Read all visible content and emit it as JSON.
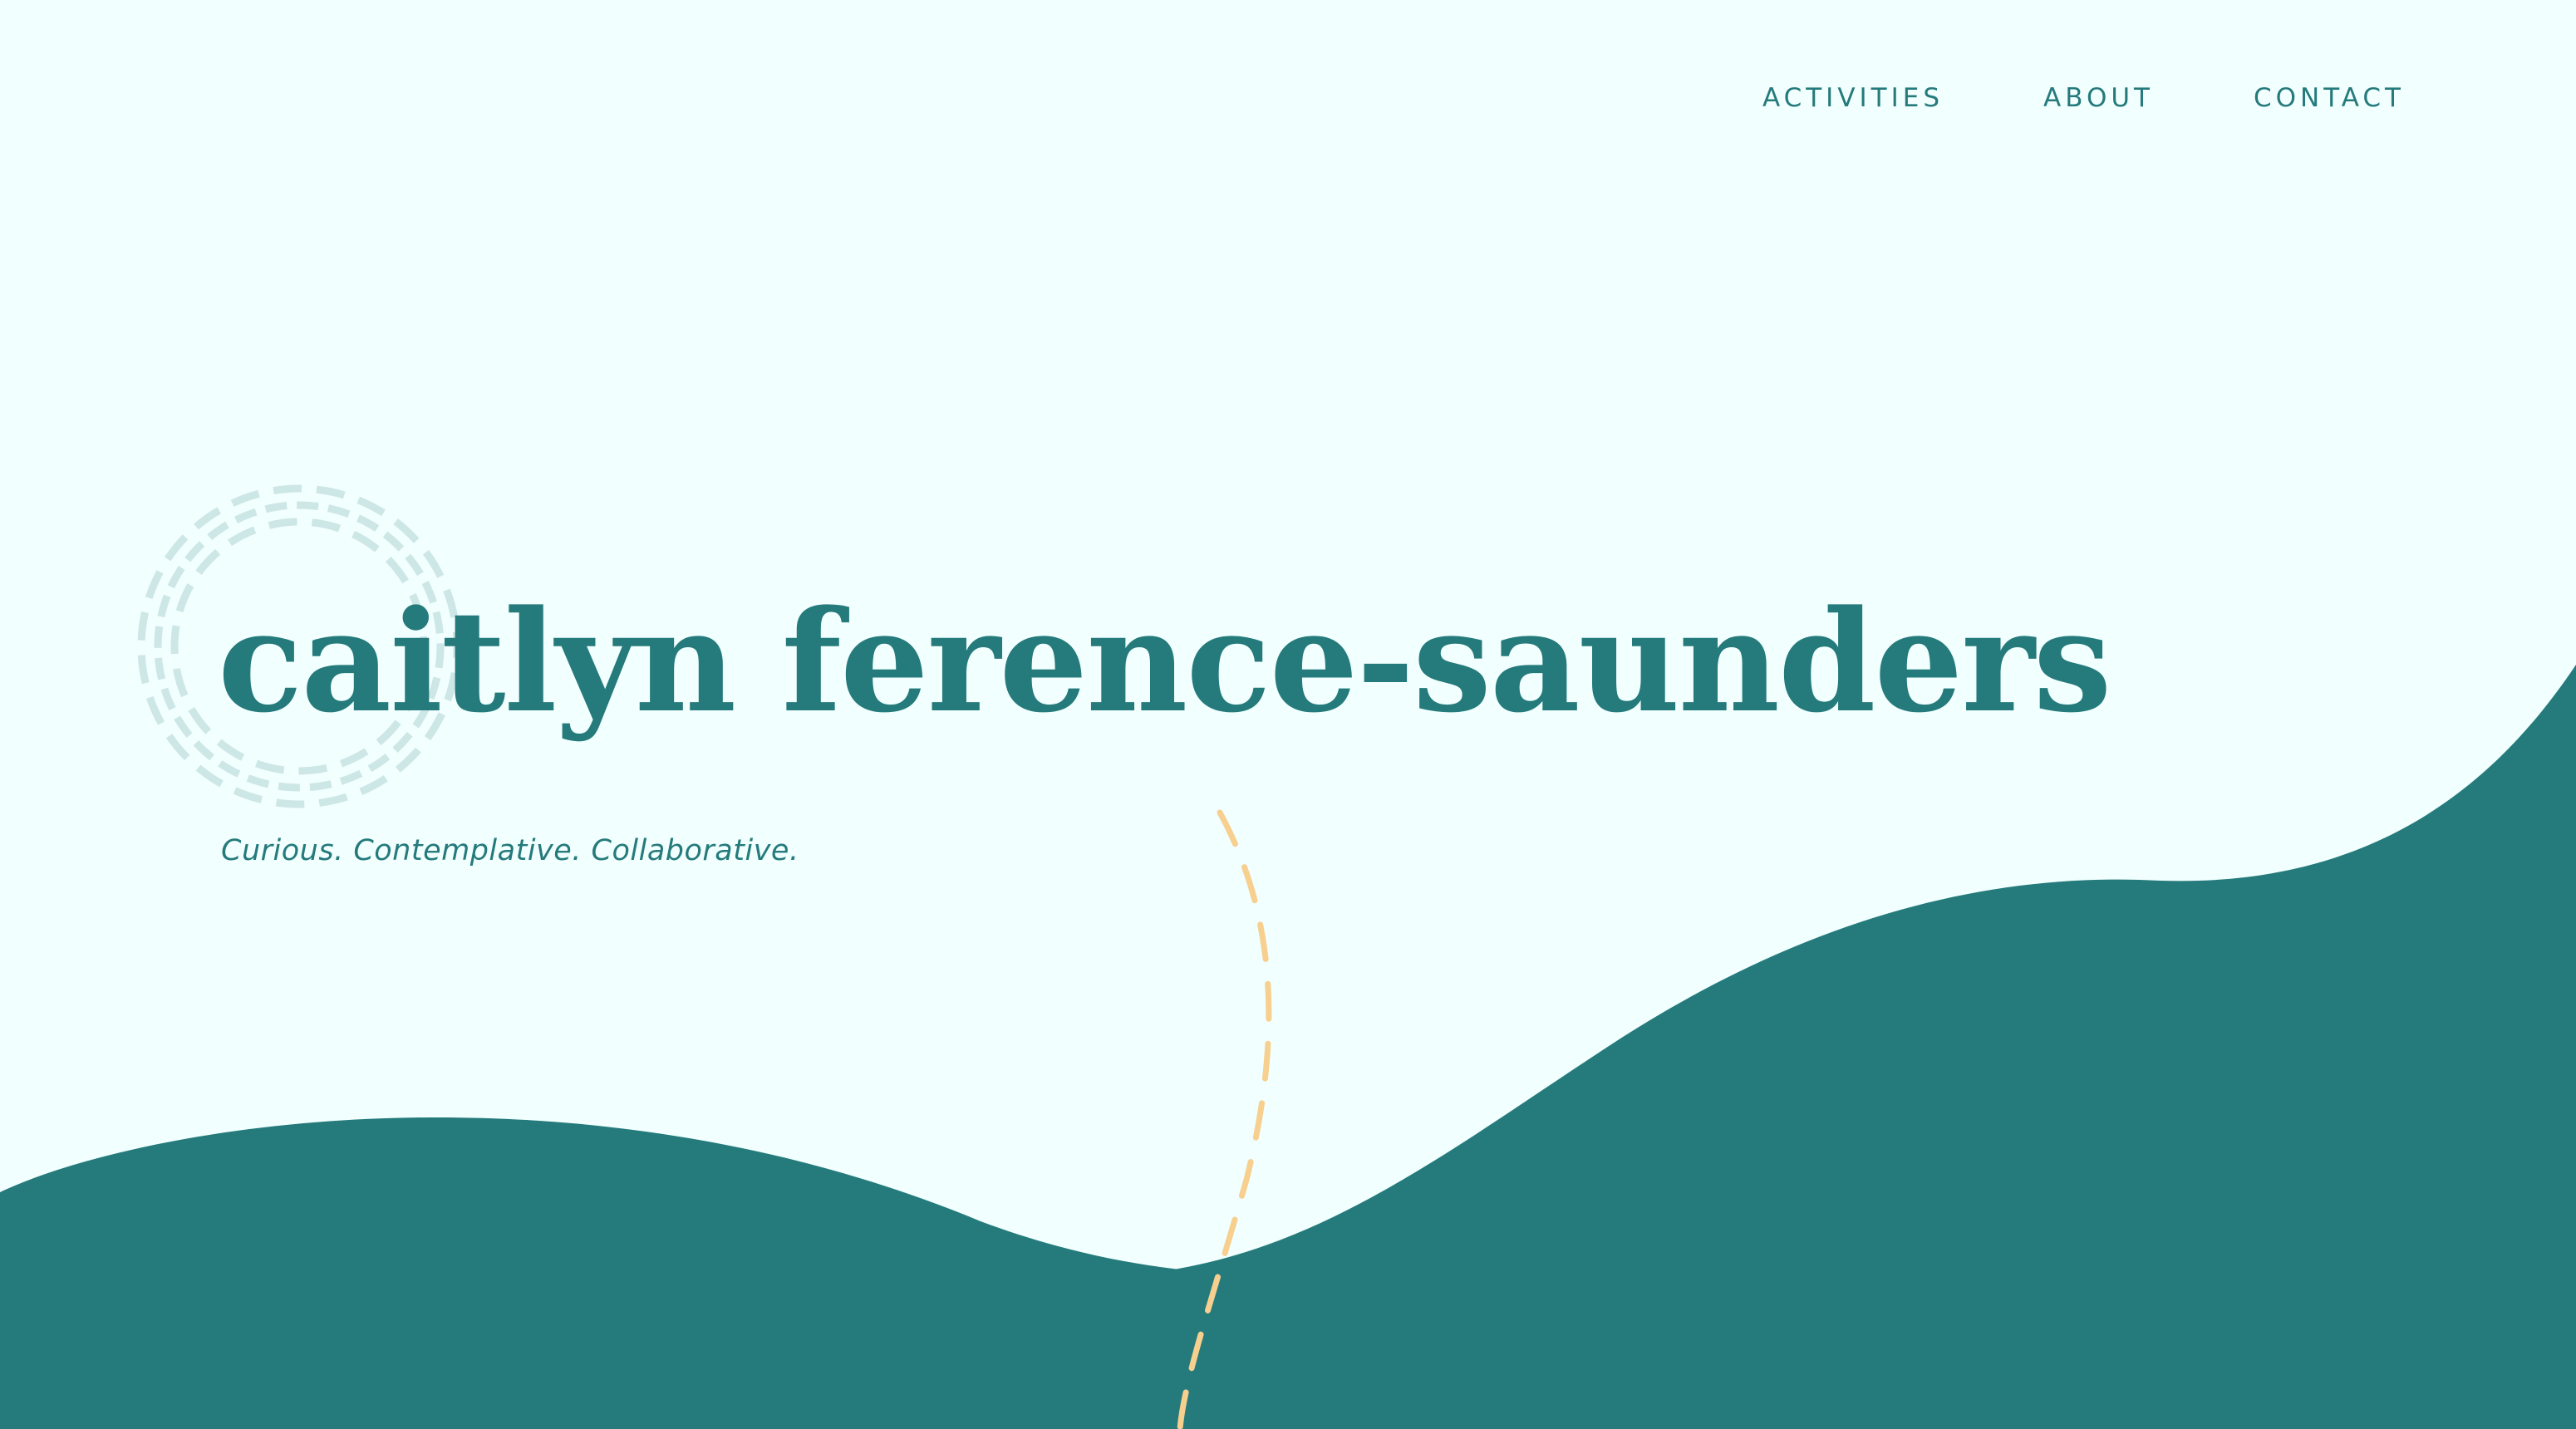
{
  "nav": {
    "items": [
      {
        "label": "ACTIVITIES"
      },
      {
        "label": "ABOUT"
      },
      {
        "label": "CONTACT"
      }
    ]
  },
  "hero": {
    "title": "caitlyn ference-saunders",
    "tagline": "Curious. Contemplative. Collaborative."
  },
  "colors": {
    "background": "#f1fffe",
    "accent": "#257a7c",
    "dash": "#f7cf8f",
    "wreath": "#cde6e6"
  },
  "decorations": {
    "wreath": "celtic-knot-wreath-icon"
  }
}
